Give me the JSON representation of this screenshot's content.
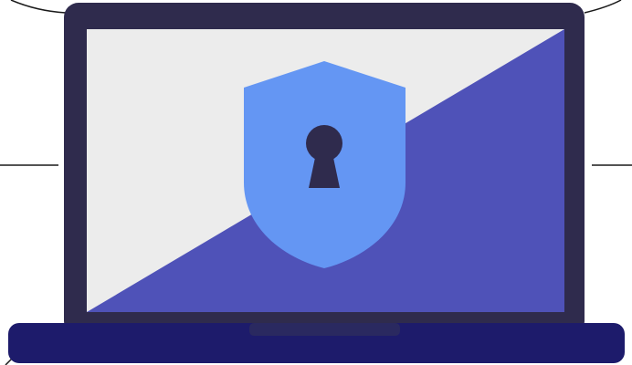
{
  "illustration": {
    "icons": {
      "laptop": "laptop-icon",
      "shield": "shield-icon",
      "keyhole": "keyhole-icon"
    },
    "colors": {
      "background": "#ffffff",
      "line": "#1a1a1a",
      "laptop_frame": "#2f2b4d",
      "screen_light": "#ececec",
      "screen_accent": "#4f52b8",
      "shield": "#6496f3",
      "keyhole": "#2f2b4d",
      "laptop_base": "#1d1b6b",
      "trackpad_notch": "#2a2960"
    }
  }
}
